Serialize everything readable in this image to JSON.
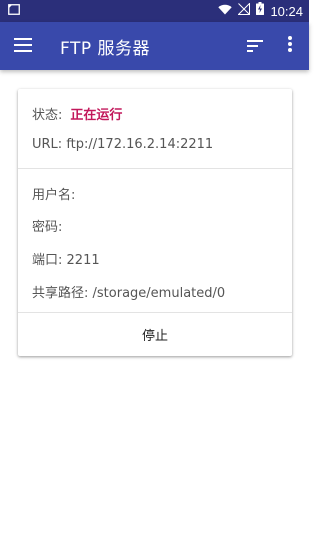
{
  "status_bar": {
    "time": "10:24",
    "icons": [
      "screenshot-icon",
      "wifi-icon",
      "signal-icon",
      "battery-icon"
    ]
  },
  "app_bar": {
    "title": "FTP 服务器",
    "icons": [
      "menu-icon",
      "sort-icon",
      "more-vert-icon"
    ],
    "color": "#3949ab"
  },
  "card": {
    "status_label": "状态:",
    "status_value": "正在运行",
    "status_color": "#c2185b",
    "url_label": "URL:",
    "url_value": "ftp://172.16.2.14:2211",
    "username_label": "用户名:",
    "username_value": "",
    "password_label": "密码:",
    "password_value": "",
    "port_label": "端口:",
    "port_value": "2211",
    "share_path_label": "共享路径:",
    "share_path_value": "/storage/emulated/0",
    "stop_button": "停止"
  }
}
